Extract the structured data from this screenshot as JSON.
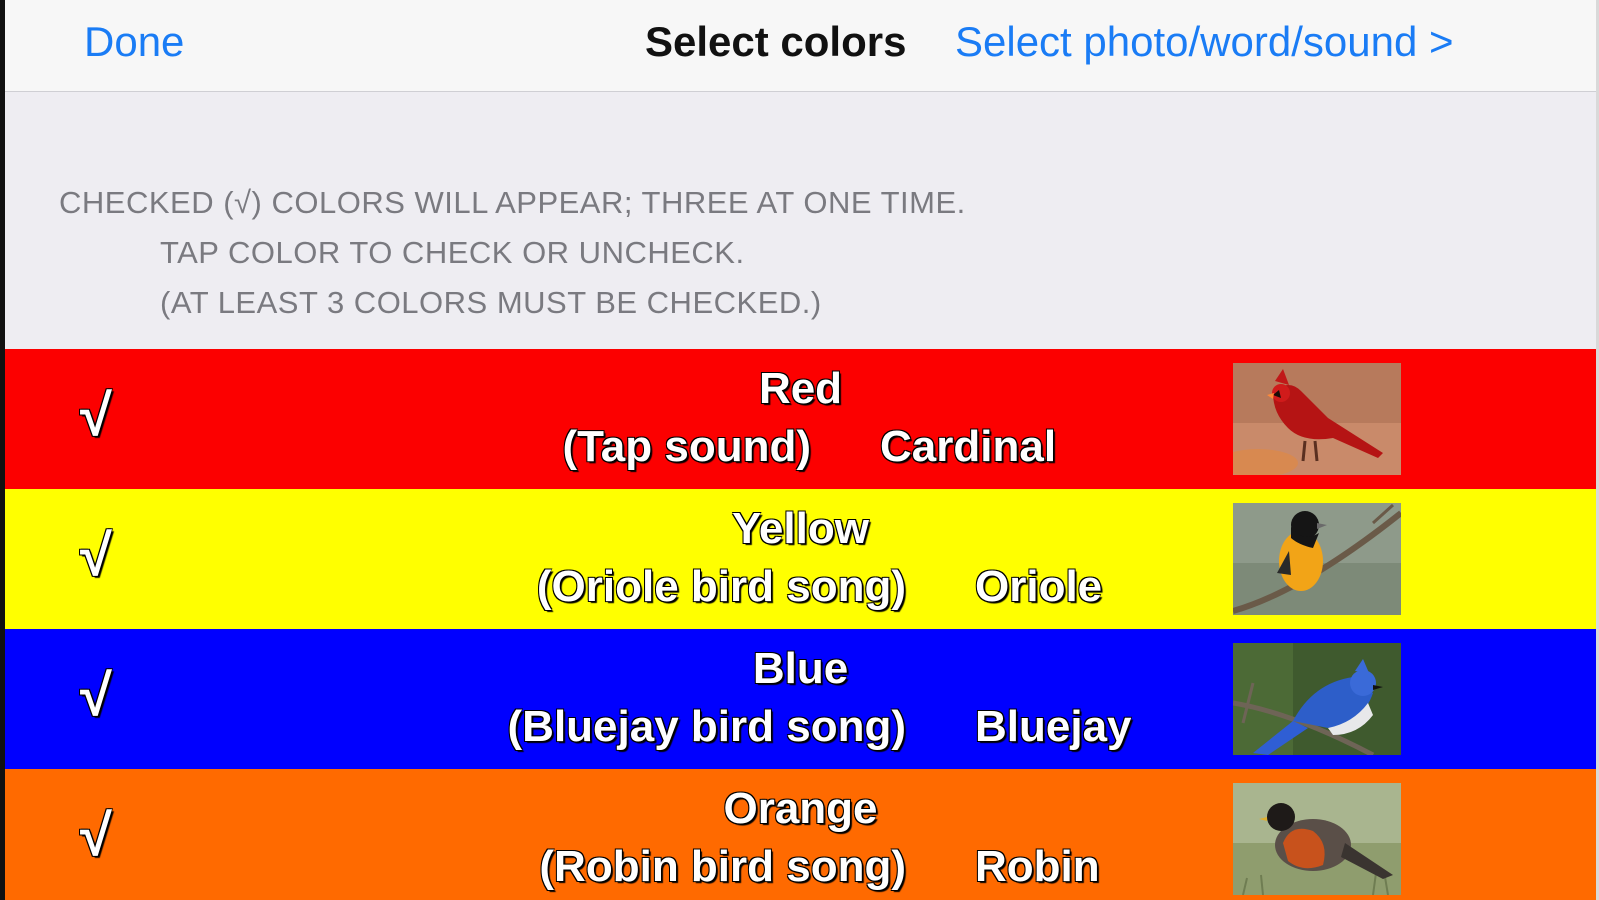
{
  "navbar": {
    "done_label": "Done",
    "title": "Select colors",
    "next_label": "Select photo/word/sound >"
  },
  "instructions": {
    "line1": "CHECKED (√) COLORS WILL APPEAR; THREE AT ONE TIME.",
    "line2": "TAP COLOR TO CHECK OR UNCHECK.",
    "line3": "(AT LEAST 3 COLORS MUST BE CHECKED.)"
  },
  "colors": [
    {
      "checked": "√",
      "name": "Red",
      "sound": "(Tap sound)",
      "word": "Cardinal",
      "bg_color": "#fc0000",
      "photo_icon": "cardinal-photo"
    },
    {
      "checked": "√",
      "name": "Yellow",
      "sound": "(Oriole bird song)",
      "word": "Oriole",
      "bg_color": "#ffff00",
      "photo_icon": "oriole-photo"
    },
    {
      "checked": "√",
      "name": "Blue",
      "sound": "(Bluejay bird song)",
      "word": "Bluejay",
      "bg_color": "#0000ff",
      "photo_icon": "bluejay-photo"
    },
    {
      "checked": "√",
      "name": "Orange",
      "sound": "(Robin bird song)",
      "word": "Robin",
      "bg_color": "#ff6a00",
      "photo_icon": "robin-photo"
    }
  ],
  "theme": {
    "link_color": "#1a7cf5",
    "header_bg": "#eeedf2",
    "instruction_color": "#7a7a80"
  }
}
